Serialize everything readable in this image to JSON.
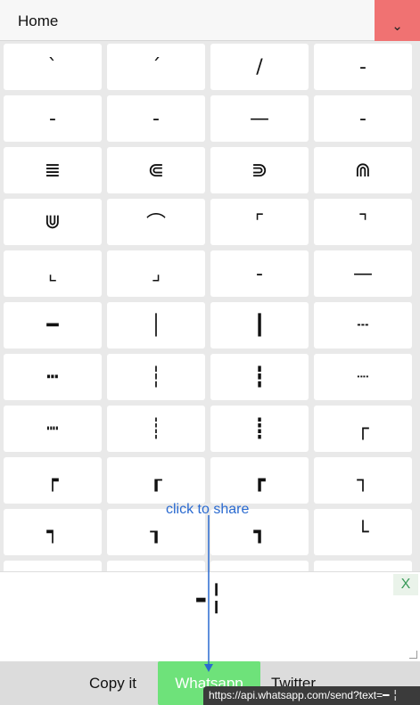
{
  "header": {
    "title": "Home",
    "menu_icon": "chevron-down-icon",
    "menu_glyph": "⌄"
  },
  "symbols": [
    "`",
    "´",
    "/",
    "-",
    "-",
    "-",
    "—",
    "-",
    "≣",
    "⋐",
    "⋑",
    "⋒",
    "⋓",
    "⌒",
    "⌜",
    "⌝",
    "⌞",
    "⌟",
    "‐",
    "—",
    "━",
    "│",
    "┃",
    "┄",
    "┅",
    "┆",
    "┇",
    "┈",
    "┉",
    "┊",
    "┋",
    "┌",
    "┍",
    "┎",
    "┏",
    "┐",
    "┑",
    "┒",
    "┓",
    "└",
    "┕",
    "┖",
    "┗",
    "┘"
  ],
  "output": {
    "text": "-╎",
    "close_label": "X"
  },
  "actions": {
    "copy_label": "Copy it",
    "whatsapp_label": "Whatsapp",
    "twitter_label": "Twitter"
  },
  "hint": {
    "share_label": "click to share"
  },
  "status_url": "https://api.whatsapp.com/send?text=━ ╎",
  "colors": {
    "menu_button": "#f07272",
    "whatsapp": "#6ee27a",
    "hint": "#2a6ad0",
    "close": "#3a9a5a"
  }
}
